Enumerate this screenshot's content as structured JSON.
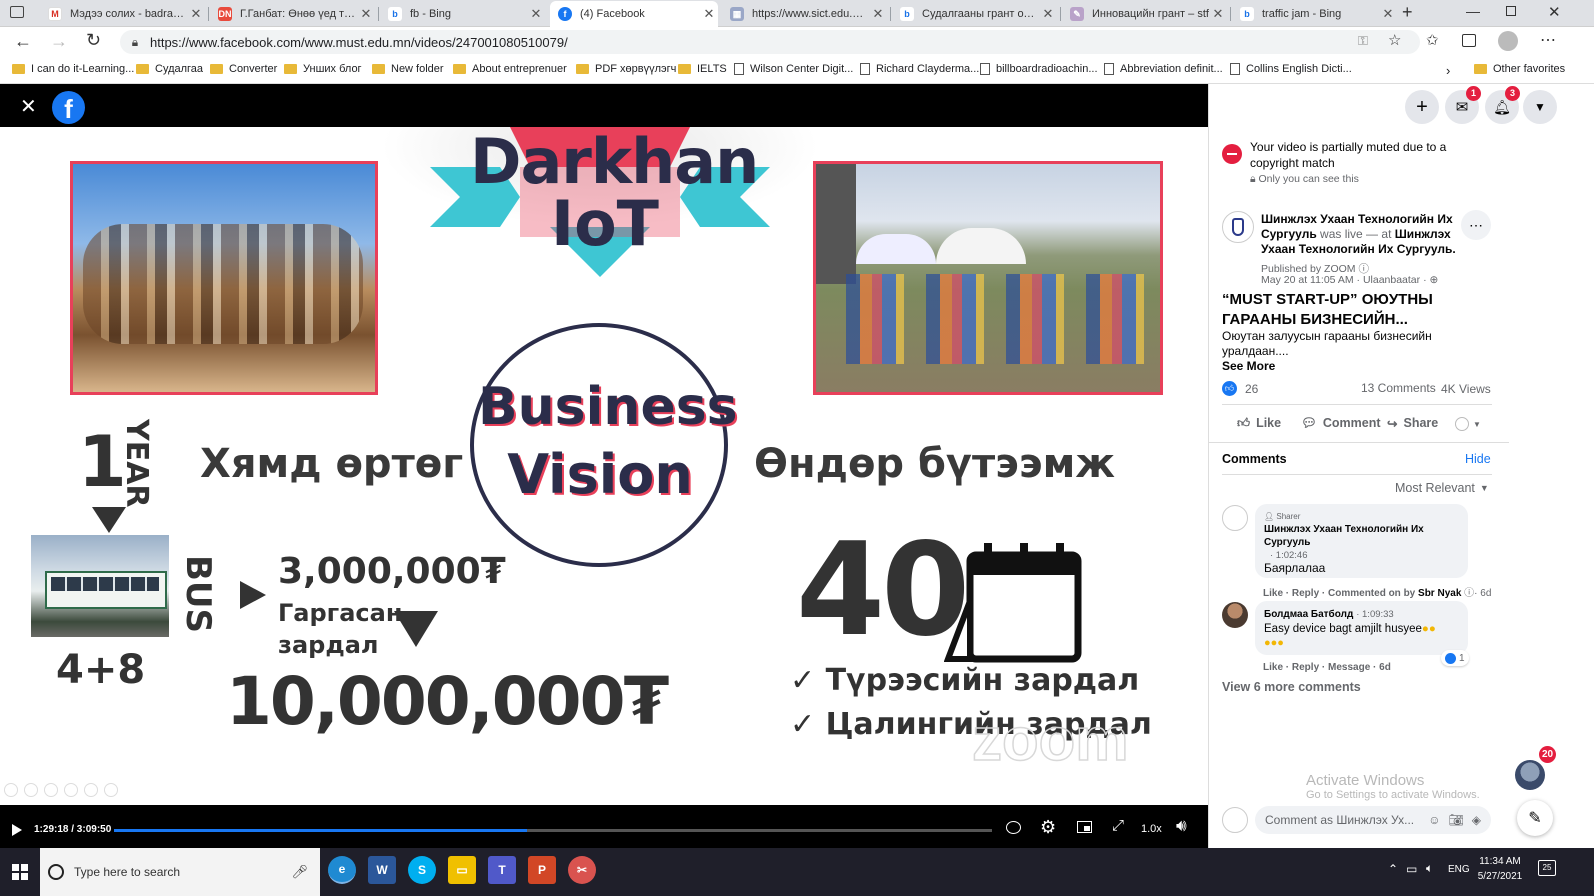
{
  "browser": {
    "tabs": [
      {
        "title": "Мэдээ солих - badrakh@"
      },
      {
        "title": "Г.Ганбат: Өнөө үед тоонц"
      },
      {
        "title": "fb - Bing"
      },
      {
        "title": "(4) Facebook"
      },
      {
        "title": "https://www.sict.edu.mn/"
      },
      {
        "title": "Судалгааны грант олгох"
      },
      {
        "title": "Инновацийн грант – stf"
      },
      {
        "title": "traffic jam - Bing"
      }
    ],
    "url": "https://www.facebook.com/www.must.edu.mn/videos/247001080510079/",
    "bookmarks": [
      "I can do it-Learning...",
      "Судалгаа",
      "Converter",
      "Унших блог",
      "New folder",
      "About entreprenuer",
      "PDF хөрвүүлэгч",
      "IELTS",
      "Wilson Center Digit...",
      "Richard Clayderma...",
      "billboardradioachin...",
      "Abbreviation definit...",
      "Collins English Dicti..."
    ],
    "other_favorites": "Other favorites"
  },
  "slide": {
    "logo_line1": "Darkhan",
    "logo_line2": "IoT",
    "circle_line1": "Business",
    "circle_line2": "Vision",
    "left_heading": "Хямд өртөг",
    "right_heading": "Өндөр бүтээмж",
    "year_num": "1",
    "year_word": "YEAR",
    "bus_word": "BUS",
    "four_eight": "4+8",
    "cost_value": "3,000,000₮",
    "cost_label1": "Гаргасан",
    "cost_label2": "зардал",
    "total_value": "10,000,000₮",
    "forty": "40",
    "check1": "✓ Түрээсийн зардал",
    "check2": "✓ Цалингийн зардал",
    "watermark": "zoom"
  },
  "player": {
    "time": "1:29:18 / 3:09:50",
    "progress": 0.47,
    "speed": "1.0x"
  },
  "panel": {
    "notice_line1": "Your video is partially muted due to a",
    "notice_line2": "copyright match",
    "notice_sub": "Only you can see this",
    "page_name": "Шинжлэх Ухаан Технологийн Их Сургууль",
    "was_live": "was live — at",
    "at_place": "Шинжлэх Ухаан Технологийн Их Сургууль.",
    "published_by": "Published by ZOOM",
    "date_line": "May 20 at 11:05 AM · Ulaanbaatar ·",
    "post_title_line1": "“MUST START-UP” ОЮУТНЫ",
    "post_title_line2": "ГАРААНЫ БИЗНЕСИЙН...",
    "post_desc_line1": "Оюутан залуусын гарааны бизнесийн",
    "post_desc_line2": "уралдаан....",
    "see_more": "See More",
    "likes": "26",
    "comments_count": "13 Comments",
    "views": "4K Views",
    "like": "Like",
    "comment": "Comment",
    "share": "Share",
    "comments_header": "Comments",
    "hide": "Hide",
    "most_relevant": "Most Relevant",
    "comments": [
      {
        "badge": "Sharer",
        "author_line1": "Шинжлэх Ухаан Технологийн Их",
        "author_line2": "Сургууль",
        "time": "· 1:02:46",
        "text": "Баярлалаа",
        "actions": "Like · Reply · Commented on by",
        "actions_name": "Sbr Nyak",
        "actions_age": "· 6d"
      },
      {
        "author": "Болдмаа Батболд",
        "time": "· 1:09:33",
        "text": "Easy device bagt amjilt husyee",
        "reactions": "1",
        "actions": "Like · Reply · Message · 6d"
      }
    ],
    "view_more": "View 6 more comments",
    "activate_line1": "Activate Windows",
    "activate_line2": "Go to Settings to activate Windows.",
    "comment_placeholder": "Comment as Шинжлэх Ух...",
    "messenger_badge": "1",
    "notif_badge": "3",
    "chat_badge": "20"
  },
  "taskbar": {
    "search_placeholder": "Type here to search",
    "lang": "ENG",
    "time": "11:34 AM",
    "date": "5/27/2021",
    "notif_count": "25"
  },
  "colors": {
    "fb_blue": "#1877f2",
    "slide_frame": "#e8405a",
    "teal": "#3ec6d3",
    "navy": "#2b2d4a"
  }
}
